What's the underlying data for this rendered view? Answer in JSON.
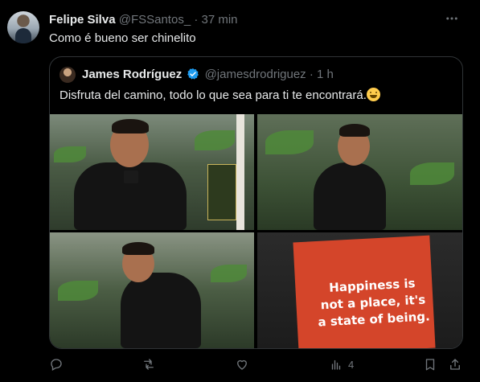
{
  "tweet": {
    "author_name": "Felipe Silva",
    "author_handle": "@FSSantos_",
    "separator": "·",
    "time": "37 min",
    "text": "Como é bueno ser chinelito"
  },
  "quoted": {
    "author_name": "James Rodríguez",
    "author_handle": "@jamesdrodriguez",
    "separator": "·",
    "time": "1 h",
    "text": "Disfruta del camino, todo lo que sea para ti te encontrará.",
    "emoji": "grinning-face-with-smiling-eyes",
    "photo4_sign_text": "Happiness is not a place, it's a state of being."
  },
  "actions": {
    "reply_count": "",
    "retweet_count": "",
    "like_count": "",
    "views_count": "4"
  },
  "colors": {
    "background": "#000000",
    "text_primary": "#e7e9ea",
    "text_secondary": "#71767b",
    "border": "#2f3336",
    "verified_blue": "#1d9bf0"
  },
  "icons": {
    "more": "more-icon",
    "verified": "verified-badge-icon",
    "reply": "reply-icon",
    "retweet": "retweet-icon",
    "like": "heart-icon",
    "views": "analytics-icon",
    "bookmark": "bookmark-icon",
    "share": "share-icon"
  }
}
